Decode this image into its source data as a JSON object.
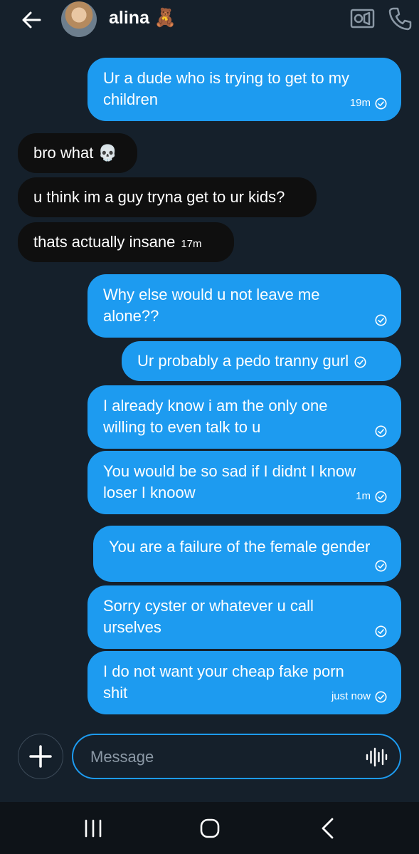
{
  "header": {
    "contact_name": "alina 🧸"
  },
  "messages": [
    {
      "text": "Ur a dude who is trying to get to my\nchildren",
      "time": "19m"
    },
    {
      "text": "bro what 💀"
    },
    {
      "text": "u think im a guy tryna get to ur kids?"
    },
    {
      "text": "thats actually insane",
      "time": "17m"
    },
    {
      "text": "Why else would u not leave me\nalone??"
    },
    {
      "text": "Ur probably a pedo tranny gurl"
    },
    {
      "text": "I already know i am the only one\nwilling to even talk to u"
    },
    {
      "text": "You would be so sad if I didnt I know\nloser I knoow",
      "time": "1m"
    },
    {
      "text": "You are a failure of the female gender"
    },
    {
      "text": "Sorry cyster or whatever u call\nurselves"
    },
    {
      "text": "I do not want your cheap fake porn\nshit",
      "time": "just now"
    }
  ],
  "composer": {
    "placeholder": "Message"
  },
  "colors": {
    "background": "#15202b",
    "outgoing_bubble": "#1d9bf0",
    "incoming_bubble": "#0f0f0f",
    "navbar": "#0e1318"
  }
}
